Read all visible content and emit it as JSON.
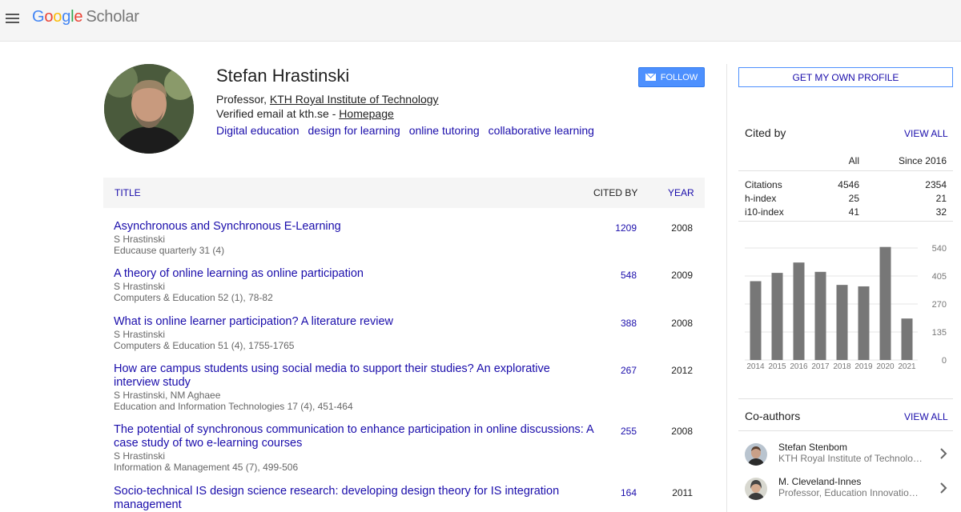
{
  "header": {
    "logo_google": [
      "G",
      "o",
      "o",
      "g",
      "l",
      "e"
    ],
    "logo_scholar": "Scholar"
  },
  "profile": {
    "name": "Stefan Hrastinski",
    "affiliation_prefix": "Professor, ",
    "affiliation_link": "KTH Royal Institute of Technology",
    "email_prefix": "Verified email at kth.se - ",
    "homepage_link": "Homepage",
    "interests": [
      "Digital education",
      "design for learning",
      "online tutoring",
      "collaborative learning"
    ],
    "follow_label": "FOLLOW"
  },
  "table": {
    "col_title": "TITLE",
    "col_cited": "CITED BY",
    "col_year": "YEAR",
    "rows": [
      {
        "title": "Asynchronous and Synchronous E-Learning",
        "authors": "S Hrastinski",
        "source": "Educause quarterly 31 (4)",
        "cited": "1209",
        "year": "2008"
      },
      {
        "title": "A theory of online learning as online participation",
        "authors": "S Hrastinski",
        "source": "Computers & Education 52 (1), 78-82",
        "cited": "548",
        "year": "2009"
      },
      {
        "title": "What is online learner participation? A literature review",
        "authors": "S Hrastinski",
        "source": "Computers & Education 51 (4), 1755-1765",
        "cited": "388",
        "year": "2008"
      },
      {
        "title": "How are campus students using social media to support their studies? An explorative interview study",
        "authors": "S Hrastinski, NM Aghaee",
        "source": "Education and Information Technologies 17 (4), 451-464",
        "cited": "267",
        "year": "2012"
      },
      {
        "title": "The potential of synchronous communication to enhance participation in online discussions: A case study of two e-learning courses",
        "authors": "S Hrastinski",
        "source": "Information & Management 45 (7), 499-506",
        "cited": "255",
        "year": "2008"
      },
      {
        "title": "Socio-technical IS design science research: developing design theory for IS integration management",
        "authors": "",
        "source": "",
        "cited": "164",
        "year": "2011"
      }
    ]
  },
  "sidebar": {
    "get_profile_label": "GET MY OWN PROFILE",
    "cited_by_title": "Cited by",
    "view_all_label": "VIEW ALL",
    "col_all": "All",
    "col_since": "Since 2016",
    "stats": [
      {
        "label": "Citations",
        "all": "4546",
        "since": "2354"
      },
      {
        "label": "h-index",
        "all": "25",
        "since": "21"
      },
      {
        "label": "i10-index",
        "all": "41",
        "since": "32"
      }
    ],
    "coauthors_title": "Co-authors",
    "coauthors_view_all": "VIEW ALL",
    "coauthors": [
      {
        "name": "Stefan Stenbom",
        "affiliation": "KTH Royal Institute of Technology"
      },
      {
        "name": "M. Cleveland-Innes",
        "affiliation": "Professor, Education Innovation, …"
      }
    ]
  },
  "chart_data": {
    "type": "bar",
    "categories": [
      "2014",
      "2015",
      "2016",
      "2017",
      "2018",
      "2019",
      "2020",
      "2021"
    ],
    "values": [
      380,
      420,
      470,
      425,
      362,
      355,
      545,
      200
    ],
    "ylim": [
      0,
      540
    ],
    "yticks": [
      0,
      135,
      270,
      405,
      540
    ],
    "bar_color": "#777777"
  }
}
